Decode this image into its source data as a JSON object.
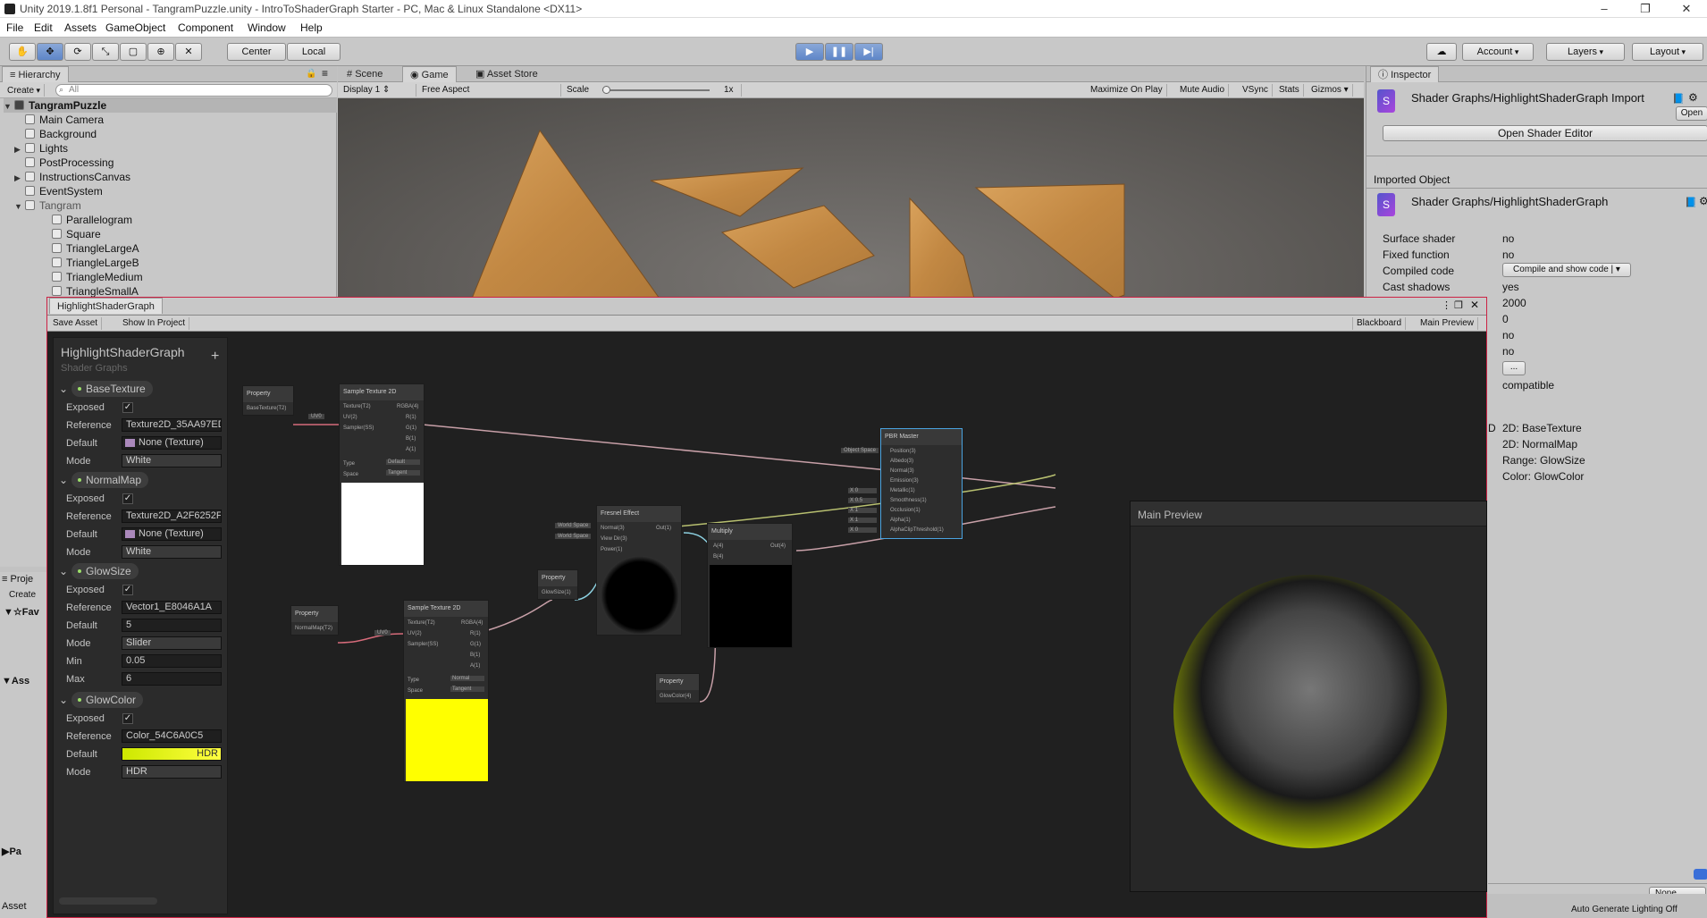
{
  "window": {
    "title": "Unity 2019.1.8f1 Personal - TangramPuzzle.unity - IntroToShaderGraph Starter - PC, Mac & Linux Standalone <DX11>"
  },
  "menu": [
    "File",
    "Edit",
    "Assets",
    "GameObject",
    "Component",
    "Window",
    "Help"
  ],
  "toolbar": {
    "center": "Center",
    "local": "Local",
    "account": "Account",
    "layers": "Layers",
    "layout": "Layout"
  },
  "hierarchy": {
    "tab": "Hierarchy",
    "create": "Create",
    "search_placeholder": "All",
    "scene": "TangramPuzzle",
    "items": [
      "Main Camera",
      "Background",
      "Lights",
      "PostProcessing",
      "InstructionsCanvas",
      "EventSystem",
      "Tangram",
      "Parallelogram",
      "Square",
      "TriangleLargeA",
      "TriangleLargeB",
      "TriangleMedium",
      "TriangleSmallA"
    ],
    "project_tab": "Proje",
    "project_create": "Create",
    "project_fav": "Fav",
    "project_assets": "Ass",
    "project_pac": "Pa",
    "project_footer": "Asset"
  },
  "game": {
    "tabs": [
      "Scene",
      "Game",
      "Asset Store"
    ],
    "display": "Display 1",
    "aspect": "Free Aspect",
    "scale_label": "Scale",
    "scale_value": "1x",
    "buttons": [
      "Maximize On Play",
      "Mute Audio",
      "VSync",
      "Stats",
      "Gizmos"
    ]
  },
  "inspector": {
    "tab": "Inspector",
    "asset_title": "Shader Graphs/HighlightShaderGraph Import",
    "open": "Open",
    "open_shader_editor": "Open Shader Editor",
    "imported_object": "Imported Object",
    "object_title": "Shader Graphs/HighlightShaderGraph",
    "rows": [
      {
        "label": "Surface shader",
        "value": "no"
      },
      {
        "label": "Fixed function",
        "value": "no"
      },
      {
        "label": "Compiled code",
        "value": "Compile and show code"
      },
      {
        "label": "Cast shadows",
        "value": "yes"
      }
    ],
    "values": [
      "2000",
      "0",
      "no",
      "no",
      "...",
      "compatible"
    ],
    "props": [
      "2D: BaseTexture",
      "2D: NormalMap",
      "Range: GlowSize",
      "Color: GlowColor"
    ],
    "props_prefix": "D",
    "footer_none": "None",
    "auto_lighting": "Auto Generate Lighting Off"
  },
  "shadergraph": {
    "tab": "HighlightShaderGraph",
    "save": "Save Asset",
    "show": "Show In Project",
    "blackboard_btn": "Blackboard",
    "preview_btn": "Main Preview",
    "bb_title": "HighlightShaderGraph",
    "bb_sub": "Shader Graphs",
    "add": "+",
    "labels": {
      "exposed": "Exposed",
      "reference": "Reference",
      "default": "Default",
      "mode": "Mode",
      "min": "Min",
      "max": "Max",
      "check": "✓"
    },
    "props": [
      {
        "name": "BaseTexture",
        "reference": "Texture2D_35AA97ED",
        "default": "None (Texture)",
        "mode": "White"
      },
      {
        "name": "NormalMap",
        "reference": "Texture2D_A2F6252F",
        "default": "None (Texture)",
        "mode": "White"
      },
      {
        "name": "GlowSize",
        "reference": "Vector1_E8046A1A",
        "default": "5",
        "mode": "Slider",
        "min": "0.05",
        "max": "6"
      },
      {
        "name": "GlowColor",
        "reference": "Color_54C6A0C5",
        "default": "HDR",
        "mode": "HDR"
      }
    ],
    "nodes": {
      "prop1": {
        "title": "Property",
        "port": "BaseTexture(T2)"
      },
      "prop2": {
        "title": "Property",
        "port": "NormalMap(T2)"
      },
      "prop3": {
        "title": "Property",
        "port": "GlowSize(1)"
      },
      "prop4": {
        "title": "Property",
        "port": "GlowColor(4)"
      },
      "st1": {
        "title": "Sample Texture 2D",
        "inputs": [
          "Texture(T2)",
          "UV(2)",
          "Sampler(SS)"
        ],
        "outputs": [
          "RGBA(4)",
          "R(1)",
          "G(1)",
          "B(1)",
          "A(1)"
        ],
        "uv": "UV0",
        "type_label": "Type",
        "type_value": "Default",
        "space_label": "Space",
        "space_value": "Tangent"
      },
      "st2": {
        "title": "Sample Texture 2D",
        "inputs": [
          "Texture(T2)",
          "UV(2)",
          "Sampler(SS)"
        ],
        "outputs": [
          "RGBA(4)",
          "R(1)",
          "G(1)",
          "B(1)",
          "A(1)"
        ],
        "uv": "UV0",
        "type_label": "Type",
        "type_value": "Normal",
        "space_label": "Space",
        "space_value": "Tangent"
      },
      "fresnel": {
        "title": "Fresnel Effect",
        "inputs": [
          "Normal(3)",
          "View Dir(3)",
          "Power(1)"
        ],
        "output": "Out(1)",
        "ws1": "World Space",
        "ws2": "World Space"
      },
      "multiply": {
        "title": "Multiply",
        "inputs": [
          "A(4)",
          "B(4)"
        ],
        "output": "Out(4)"
      },
      "master": {
        "title": "PBR Master",
        "inputs": [
          "Position(3)",
          "Albedo(3)",
          "Normal(3)",
          "Emission(3)",
          "Metallic(1)",
          "Smoothness(1)",
          "Occlusion(1)",
          "Alpha(1)",
          "AlphaClipThreshold(1)"
        ],
        "objspace": "Object Space",
        "x": "X",
        "vals": [
          "0",
          "0.5",
          "1",
          "1",
          "0"
        ]
      }
    },
    "main_preview": "Main Preview"
  }
}
